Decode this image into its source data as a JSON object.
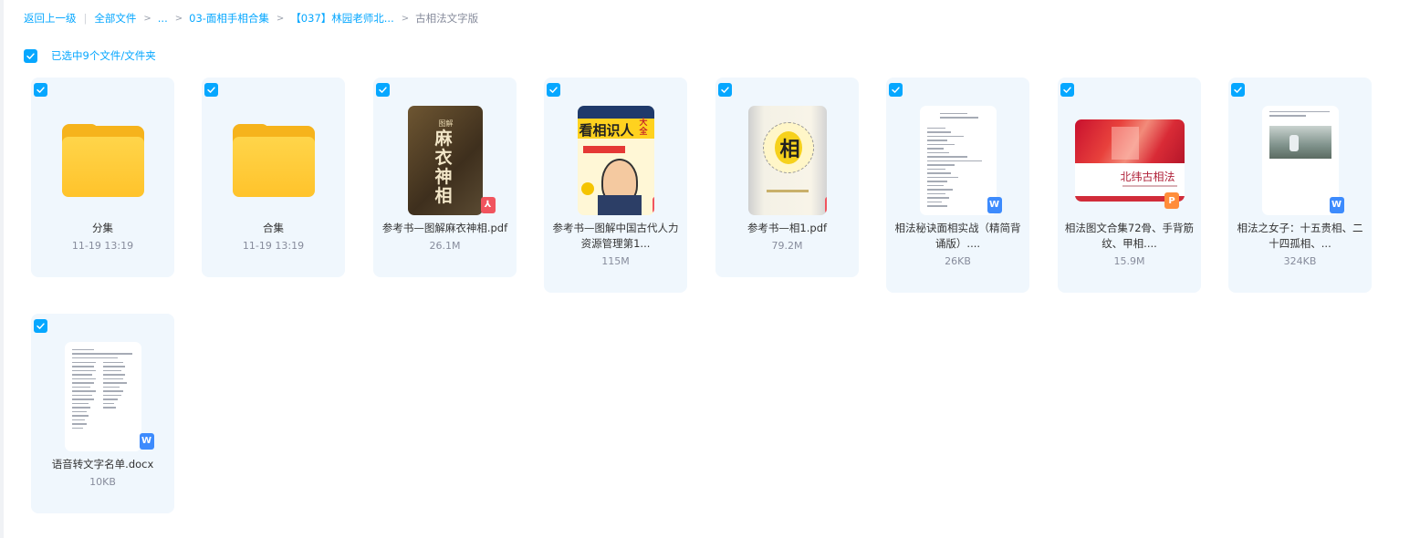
{
  "breadcrumb": {
    "back": "返回上一级",
    "all_files": "全部文件",
    "ellipsis": "...",
    "level1": "03-面相手相合集",
    "level2": "【037】林园老师北...",
    "current": "古相法文字版"
  },
  "selection": {
    "text": "已选中9个文件/文件夹"
  },
  "files": [
    {
      "name": "分集",
      "meta": "11-19 13:19",
      "type": "folder",
      "icon": "folder-icon"
    },
    {
      "name": "合集",
      "meta": "11-19 13:19",
      "type": "folder",
      "icon": "folder-icon"
    },
    {
      "name": "参考书—图解麻衣神相.pdf",
      "meta": "26.1M",
      "type": "pdf",
      "icon": "pdf-icon",
      "cover_text": "麻衣神相",
      "cover_small": "图解"
    },
    {
      "name": "参考书—图解中国古代人力资源管理第1...",
      "meta": "115M",
      "type": "pdf",
      "icon": "pdf-icon",
      "cover_text": "看相识人",
      "cover_small": "大全"
    },
    {
      "name": "参考书—相1.pdf",
      "meta": "79.2M",
      "type": "pdf",
      "icon": "pdf-icon",
      "cover_text": "相"
    },
    {
      "name": "相法秘诀面相实战（精简背诵版）....",
      "meta": "26KB",
      "type": "word",
      "icon": "word-icon"
    },
    {
      "name": "相法图文合集72骨、手背筋纹、甲相....",
      "meta": "15.9M",
      "type": "ppt",
      "icon": "ppt-icon",
      "cover_text": "北纬古相法"
    },
    {
      "name": "相法之女子：十五贵相、二十四孤相、...",
      "meta": "324KB",
      "type": "word",
      "icon": "word-icon"
    },
    {
      "name": "语音转文字名单.docx",
      "meta": "10KB",
      "type": "word",
      "icon": "word-icon"
    }
  ],
  "badges": {
    "pdf": "⅄",
    "word": "W",
    "ppt": "P"
  },
  "colors": {
    "accent": "#06a7ff",
    "card_bg": "#f0f7fd",
    "folder": "#ffc32b",
    "pdf": "#f1545e",
    "word": "#3d8bfd",
    "ppt": "#ff8d3a"
  }
}
